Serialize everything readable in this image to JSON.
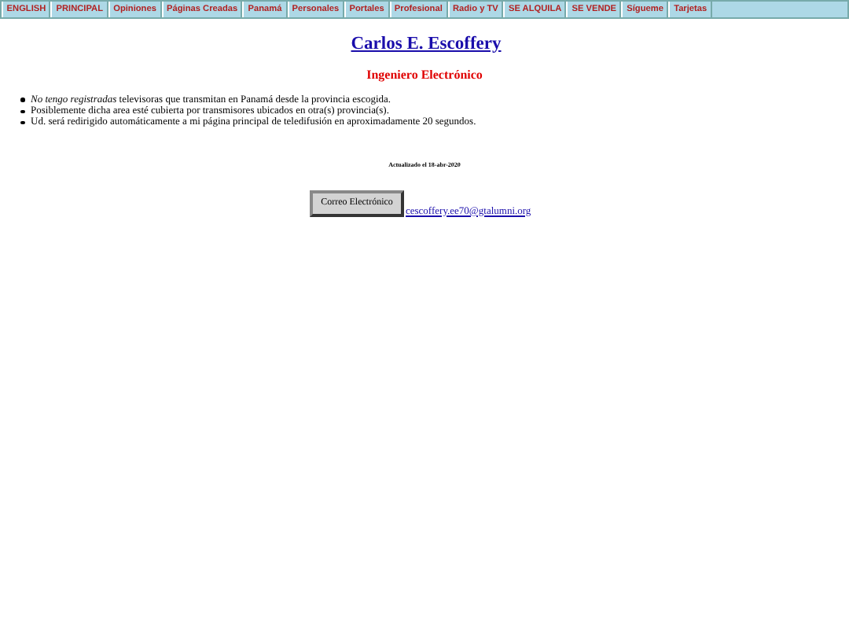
{
  "nav": [
    "ENGLISH",
    "PRINCIPAL",
    "Opiniones",
    "Páginas Creadas",
    "Panamá",
    "Personales",
    "Portales",
    "Profesional",
    "Radio y TV",
    "SE ALQUILA",
    "SE VENDE",
    "Sígueme",
    "Tarjetas"
  ],
  "title": "Carlos E. Escoffery",
  "subtitle": "Ingeniero Electrónico",
  "bullets": [
    "*No tengo registradas* televisoras que transmitan en Panamá desde la provincia escogida.",
    "Posiblemente dicha area esté cubierta por transmisores ubicados en otra(s) provincia(s).",
    "Ud. será redirigido automáticamente a mi página principal de teledifusión en aproximadamente 20 segundos."
  ],
  "updated": "Actualizado el 18-abr-2020",
  "email_button": "Correo Electrónico",
  "email_link": "cescoffery.ee70@gtalumni.org"
}
